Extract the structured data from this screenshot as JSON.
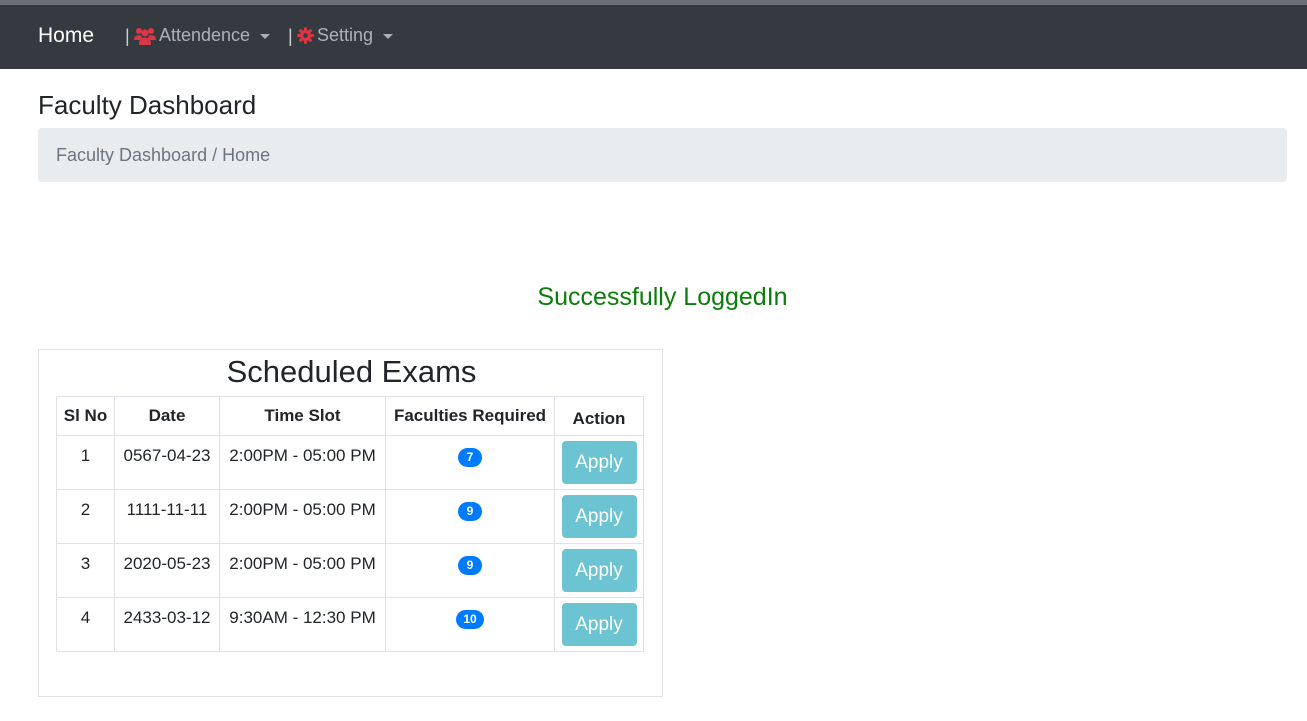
{
  "navbar": {
    "brand": "Home",
    "separator": "|",
    "menus": [
      {
        "label": "Attendence",
        "icon": "users-icon"
      },
      {
        "label": "Setting",
        "icon": "gear-icon"
      }
    ],
    "icon_color": "#dc3545"
  },
  "page": {
    "title": "Faculty Dashboard",
    "breadcrumb": "Faculty Dashboard / Home"
  },
  "message": {
    "text": "Successfully LoggedIn",
    "color": "#0a7d0a"
  },
  "exams": {
    "title": "Scheduled Exams",
    "columns": [
      "Sl No",
      "Date",
      "Time Slot",
      "Faculties Required",
      "Action"
    ],
    "rows": [
      {
        "sl": "1",
        "date": "0567-04-23",
        "time": "2:00PM - 05:00 PM",
        "faculties": "7",
        "action": "Apply"
      },
      {
        "sl": "2",
        "date": "1111-11-11",
        "time": "2:00PM - 05:00 PM",
        "faculties": "9",
        "action": "Apply"
      },
      {
        "sl": "3",
        "date": "2020-05-23",
        "time": "2:00PM - 05:00 PM",
        "faculties": "9",
        "action": "Apply"
      },
      {
        "sl": "4",
        "date": "2433-03-12",
        "time": "9:30AM - 12:30 PM",
        "faculties": "10",
        "action": "Apply"
      }
    ],
    "badge_color": "#007bff",
    "button_color": "#6cc3d1"
  }
}
